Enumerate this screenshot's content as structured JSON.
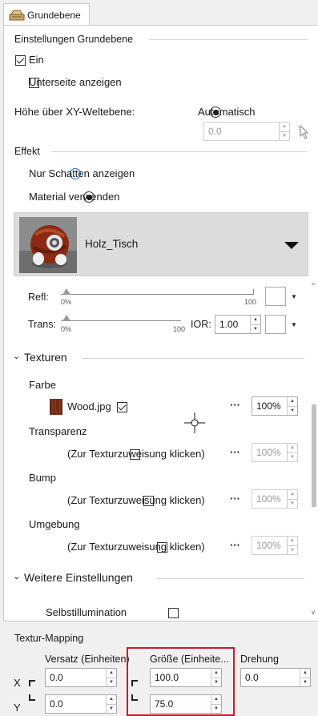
{
  "tab": {
    "label": "Grundebene"
  },
  "settings": {
    "heading": "Einstellungen Grundebene",
    "on_label": "Ein",
    "underside_label": "Unterseite anzeigen",
    "height_label": "Höhe über XY-Weltebene:",
    "auto_label": "Automatisch",
    "height_value": "0.0"
  },
  "effect": {
    "heading": "Effekt",
    "shadow_label": "Nur Schatten anzeigen",
    "material_label": "Material verwenden",
    "material_name": "Holz_Tisch"
  },
  "refl": {
    "label": "Refl:",
    "min": "0%",
    "max": "100"
  },
  "trans": {
    "label": "Trans:",
    "min": "0%",
    "max": "100",
    "ior_label": "IOR:",
    "ior_value": "1.00"
  },
  "textures": {
    "heading": "Texturen",
    "rows": [
      {
        "title": "Farbe",
        "file": "Wood.jpg",
        "checked": true,
        "percent": "100%",
        "dots": "···"
      },
      {
        "title": "Transparenz",
        "file": "(Zur Texturzuweisung klicken)",
        "checked": false,
        "percent": "100%",
        "dots": "···"
      },
      {
        "title": "Bump",
        "file": "(Zur Texturzuweisung klicken)",
        "checked": false,
        "percent": "100%",
        "dots": "···"
      },
      {
        "title": "Umgebung",
        "file": "(Zur Texturzuweisung klicken)",
        "checked": false,
        "percent": "100%",
        "dots": "···"
      }
    ]
  },
  "more": {
    "heading": "Weitere Einstellungen",
    "selfillum_label": "Selbstillumination"
  },
  "mapping": {
    "heading": "Textur-Mapping",
    "col_offset": "Versatz (Einheiten)",
    "col_size": "Größe (Einheite...",
    "col_rotation": "Drehung",
    "x_label": "X",
    "y_label": "Y",
    "x_offset": "0.0",
    "x_size": "100.0",
    "x_rotation": "0.0",
    "y_offset": "0.0",
    "y_size": "75.0"
  },
  "colors": {
    "highlight": "#c81c28",
    "radio_blue": "#1e6fd0"
  }
}
